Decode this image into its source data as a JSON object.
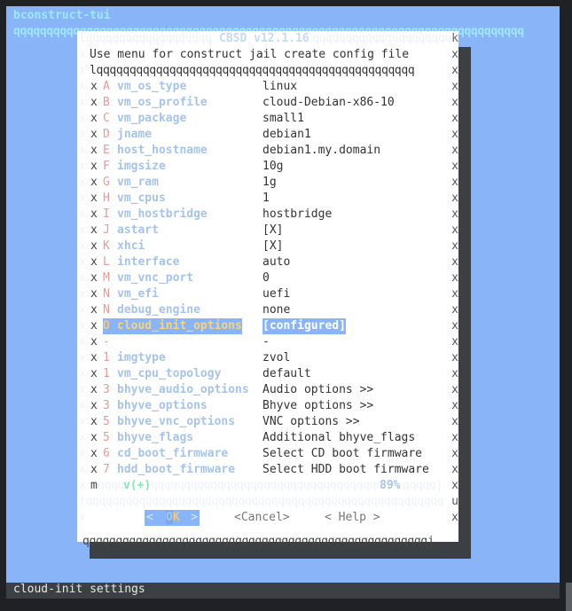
{
  "app": {
    "title": "bconstruct-tui",
    "top_rule": "qqqqqqqqqqqqqqqqqqqqqqqqqqqqqqqqqqqqqqqqqqqqqqqqqqqqqqqqqqqqqqqqqqqqqqqqqqqqq"
  },
  "dialog": {
    "title": "CBSD v12.1.16",
    "title_left_rule": "lqqqqqqqqqqqqqqqqqqq ",
    "title_right_rule": " qqqqqqqqqqqqqqqqqqqqq",
    "corner_top_right": "k",
    "hint": "Use menu for construct jail create config file",
    "menu_top_rule": "lqqqqqqqqqqqqqqqqqqqqqqqqqqqqqqqqqqqqqqqqqqqqqqqq",
    "edge_char": "x",
    "items": [
      {
        "key": "A",
        "name": "vm_os_type",
        "value": "linux"
      },
      {
        "key": "B",
        "name": "vm_os_profile",
        "value": "cloud-Debian-x86-10"
      },
      {
        "key": "C",
        "name": "vm_package",
        "value": "small1"
      },
      {
        "key": "D",
        "name": "jname",
        "value": "debian1"
      },
      {
        "key": "E",
        "name": "host_hostname",
        "value": "debian1.my.domain"
      },
      {
        "key": "F",
        "name": "imgsize",
        "value": "10g"
      },
      {
        "key": "G",
        "name": "vm_ram",
        "value": "1g"
      },
      {
        "key": "H",
        "name": "vm_cpus",
        "value": "1"
      },
      {
        "key": "I",
        "name": "vm_hostbridge",
        "value": "hostbridge"
      },
      {
        "key": "J",
        "name": "astart",
        "value": "[X]"
      },
      {
        "key": "K",
        "name": "xhci",
        "value": "[X]"
      },
      {
        "key": "L",
        "name": "interface",
        "value": "auto"
      },
      {
        "key": "M",
        "name": "vm_vnc_port",
        "value": "0"
      },
      {
        "key": "N",
        "name": "vm_efi",
        "value": "uefi"
      },
      {
        "key": "N",
        "name": "debug_engine",
        "value": "none"
      },
      {
        "key": "O",
        "name": "cloud_init_options",
        "value": "[configured]",
        "selected": true
      },
      {
        "key": "-",
        "name": "",
        "value": "-"
      },
      {
        "key": "1",
        "name": "imgtype",
        "value": "zvol"
      },
      {
        "key": "1",
        "name": "vm_cpu_topology",
        "value": "default"
      },
      {
        "key": "3",
        "name": "bhyve_audio_options",
        "value": "Audio options >>"
      },
      {
        "key": "3",
        "name": "bhyve_options",
        "value": "Bhyve options >>"
      },
      {
        "key": "5",
        "name": "bhyve_vnc_options",
        "value": "VNC options >>"
      },
      {
        "key": "5",
        "name": "bhyve_flags",
        "value": "Additional bhyve_flags"
      },
      {
        "key": "6",
        "name": "cd_boot_firmware",
        "value": "Select CD boot firmware"
      },
      {
        "key": "7",
        "name": "hdd_boot_firmware",
        "value": "Select HDD boot firmware"
      }
    ],
    "scroll": {
      "corner": "m",
      "rule_left": "qqqq",
      "more_indicator": "v(+)",
      "rule_mid": "qqqqqqqqqqqqqqqqqqqqqqqqqqqqqqqqqqq",
      "percent": "89%",
      "rule_right": "qqqqqj"
    },
    "separator_rule": "tqqqqqqqqqqqqqqqqqqqqqqqqqqqqqqqqqqqqqqqqqqqqqqqqqqqqqq",
    "separator_corner": "u",
    "buttons": {
      "ok_left": "<",
      "ok_first": "O",
      "ok_rest": "K",
      "ok_right": ">",
      "cancel": "<Cancel>",
      "help": "< Help >"
    },
    "bottom_rule": "qqqqqqqqqqqqqqqqqqqqqqqqqqqqqqqqqqqqqqqqqqqqqqqqqqqqj"
  },
  "status_bar": {
    "text": "cloud-init settings"
  }
}
